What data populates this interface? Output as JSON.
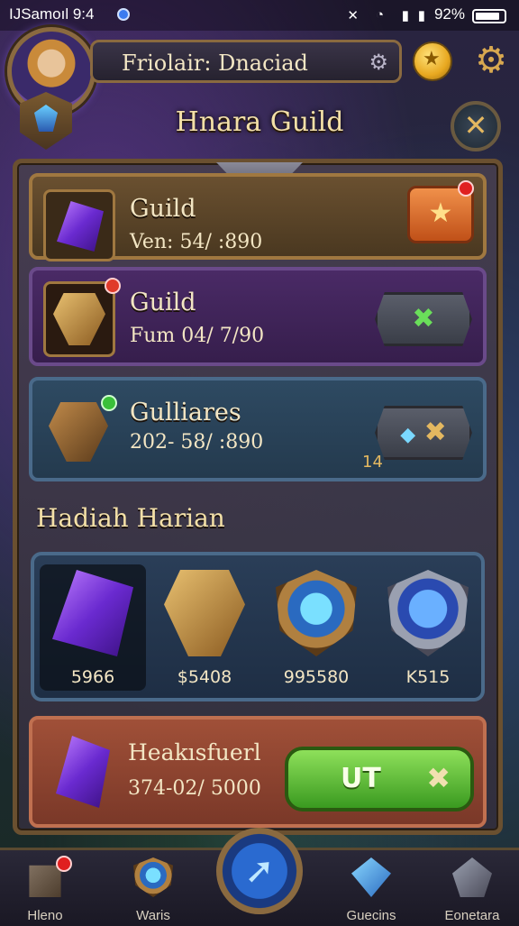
{
  "status_bar": {
    "carrier_time": "IJSamoıl 9:4",
    "battery_text": "92%"
  },
  "header": {
    "player_name": "Friolair: Dnaciad"
  },
  "title": "Hnara Guild",
  "guild_cards": [
    {
      "name": "Guild",
      "meta": "Ven: 54/ :890"
    },
    {
      "name": "Guild",
      "meta": "Fum 04/ 7/90"
    },
    {
      "name": "Gulliares",
      "meta": "202- 58/ :890",
      "badge": "14"
    }
  ],
  "rewards_section": {
    "heading": "Hadiah Harian",
    "items": [
      {
        "value": "5966",
        "icon": "purple-gem-icon"
      },
      {
        "value": "$5408",
        "icon": "golden-armor-icon"
      },
      {
        "value": "995580",
        "icon": "blue-shield-icon"
      },
      {
        "value": "K515",
        "icon": "steel-shield-icon"
      }
    ]
  },
  "featured": {
    "name": "Heakısfuerl",
    "meta": "374-02/ 5000",
    "button_label": "UT"
  },
  "bottom_nav": [
    {
      "label": "Hleno"
    },
    {
      "label": "Waris"
    },
    {
      "label": "Guecins"
    },
    {
      "label": "Eonetara"
    }
  ],
  "colors": {
    "accent_gold": "#e4b860",
    "green_button": "#3a9a20",
    "orange_button": "#c05018",
    "notification_red": "#e02020"
  }
}
